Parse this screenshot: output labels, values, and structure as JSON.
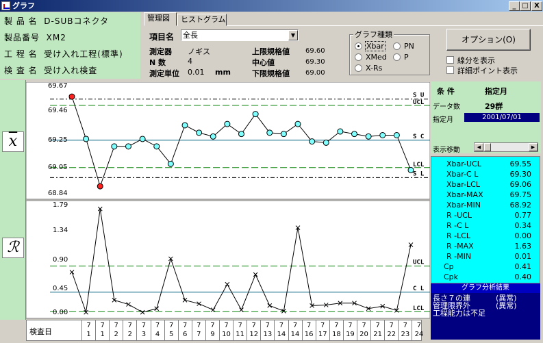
{
  "window": {
    "title": "グラフ",
    "min": "_",
    "max": "□",
    "close": "X"
  },
  "info": {
    "product_name_label": "製 品 名",
    "product_name": "D-SUBコネクタ",
    "product_no_label": "製品番号",
    "product_no": "XM2",
    "process_label": "工 程 名",
    "process": "受け入れ工程(標準)",
    "inspect_label": "検 査 名",
    "inspect": "受け入れ検査"
  },
  "tabs": [
    "管理図",
    "ヒストグラム"
  ],
  "item": {
    "label": "項目名",
    "value": "全長"
  },
  "measure": {
    "device_label": "測定器",
    "device": "ノギス",
    "n_label": "N 数",
    "n": "4",
    "unit_label": "測定単位",
    "unit_value": "0.01",
    "unit": "mm",
    "usl_label": "上限規格値",
    "usl": "69.60",
    "center_label": "中心値",
    "center": "69.30",
    "lsl_label": "下限規格値",
    "lsl": "69.00"
  },
  "graph_type": {
    "title": "グラフ種類",
    "options": [
      "Xbar",
      "XMed",
      "X-Rs",
      "PN",
      "P"
    ],
    "selected": "Xbar"
  },
  "option_button": "オプション(O)",
  "checks": [
    "線分を表示",
    "詳細ポイント表示"
  ],
  "xbar_axis": [
    "69.67",
    "69.46",
    "69.25",
    "69.05",
    "68.84"
  ],
  "r_axis": [
    "1.79",
    "1.34",
    "0.90",
    "0.45",
    "0.00"
  ],
  "xbar_labels": [
    "S U",
    "UCL",
    "S C",
    "LCL",
    "S L"
  ],
  "r_labels": [
    "UCL",
    "C L",
    "LCL"
  ],
  "day_label": "検査日",
  "days": [
    {
      "m": "7",
      "d": "1"
    },
    {
      "m": "7",
      "d": "1"
    },
    {
      "m": "7",
      "d": "2"
    },
    {
      "m": "7",
      "d": "2"
    },
    {
      "m": "7",
      "d": "3"
    },
    {
      "m": "7",
      "d": "4"
    },
    {
      "m": "7",
      "d": "5"
    },
    {
      "m": "7",
      "d": "6"
    },
    {
      "m": "7",
      "d": "7"
    },
    {
      "m": "7",
      "d": "9"
    },
    {
      "m": "7",
      "d": "10"
    },
    {
      "m": "7",
      "d": "11"
    },
    {
      "m": "7",
      "d": "12"
    },
    {
      "m": "7",
      "d": "13"
    },
    {
      "m": "7",
      "d": "14"
    },
    {
      "m": "7",
      "d": "14"
    },
    {
      "m": "7",
      "d": "16"
    },
    {
      "m": "7",
      "d": "17"
    },
    {
      "m": "7",
      "d": "18"
    },
    {
      "m": "7",
      "d": "19"
    },
    {
      "m": "7",
      "d": "20"
    },
    {
      "m": "7",
      "d": "21"
    },
    {
      "m": "7",
      "d": "22"
    },
    {
      "m": "7",
      "d": "23"
    },
    {
      "m": "7",
      "d": "24"
    }
  ],
  "cond": {
    "label": "条 件",
    "value": "指定月",
    "count_label": "データ数",
    "count": "29群",
    "month_label": "指定月",
    "month": "2001/07/01",
    "move_label": "表示移動"
  },
  "stats": [
    {
      "k": "Xbar-UCL",
      "v": "69.55"
    },
    {
      "k": "Xbar-C L",
      "v": "69.30"
    },
    {
      "k": "Xbar-LCL",
      "v": "69.06"
    },
    {
      "k": "Xbar-MAX",
      "v": "69.75"
    },
    {
      "k": "Xbar-MIN",
      "v": "68.92"
    },
    {
      "k": "R -UCL",
      "v": "0.77"
    },
    {
      "k": "R -C L",
      "v": "0.34"
    },
    {
      "k": "R -LCL",
      "v": "0.00"
    },
    {
      "k": "R -MAX",
      "v": "1.63"
    },
    {
      "k": "R -MIN",
      "v": "0.01"
    },
    {
      "k": "Cp",
      "v": "0.41"
    },
    {
      "k": "Cpk",
      "v": "0.40"
    }
  ],
  "result_title": "グラフ分析結果",
  "result_lines": [
    {
      "a": "長さ７の連",
      "b": "(異常)"
    },
    {
      "a": "管理限界外",
      "b": "(異常)"
    },
    {
      "a": "工程能力は不足",
      "b": ""
    }
  ],
  "colors": {
    "bg": "#d4d0c8",
    "info_green": "#c0e8c0",
    "cyan": "#00ffff",
    "navy": "#000080",
    "point": "#80ffff",
    "out": "#ff0000"
  },
  "chart_data": [
    {
      "type": "line",
      "title": "",
      "ylim": [
        68.84,
        69.67
      ],
      "series": [
        {
          "values": [
            69.62,
            69.28,
            68.9,
            69.22,
            69.22,
            69.28,
            69.22,
            69.08,
            69.39,
            69.33,
            69.3,
            69.4,
            69.32,
            69.48,
            69.33,
            69.32,
            69.4,
            69.26,
            69.25,
            69.34,
            69.32,
            69.3,
            69.31,
            69.31,
            69.03
          ]
        }
      ],
      "lines": {
        "SU": 69.6,
        "UCL": 69.55,
        "SC": 69.27,
        "LCL": 69.05,
        "SL": 68.97
      }
    },
    {
      "type": "line",
      "title": "",
      "ylim": [
        0,
        1.79
      ],
      "series": [
        {
          "values": [
            0.67,
            0.01,
            1.71,
            0.21,
            0.14,
            0.01,
            0.07,
            0.89,
            0.21,
            0.15,
            0.05,
            0.47,
            0.05,
            0.63,
            0.12,
            0.03,
            1.4,
            0.12,
            0.13,
            0.16,
            0.16,
            0.07,
            0.11,
            0.04,
            1.12
          ]
        }
      ],
      "lines": {
        "UCL": 0.77,
        "CL": 0.34,
        "LCL": 0.0
      }
    }
  ]
}
